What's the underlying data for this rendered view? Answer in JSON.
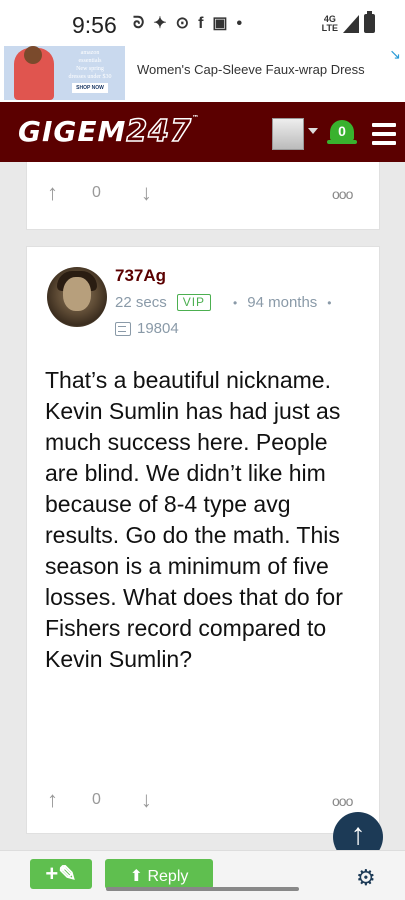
{
  "status_bar": {
    "time": "9:56",
    "network_top": "4G",
    "network_bottom": "LTE",
    "icons": [
      "game-icon",
      "twitter-icon",
      "radio-icon",
      "facebook-icon",
      "image-icon",
      "dot-icon"
    ]
  },
  "ad": {
    "image_line1": "amazon",
    "image_line2": "essentials",
    "image_line3": "New spring",
    "image_line4": "dresses under $30",
    "image_cta": "SHOP NOW",
    "title": "Women's Cap-Sleeve Faux-wrap Dress"
  },
  "header": {
    "logo_text": "GIGEM",
    "logo_number": "247",
    "logo_tm": "™",
    "notification_count": "0"
  },
  "prev_post": {
    "vote_count": "0"
  },
  "post": {
    "username": "737Ag",
    "time_ago": "22 secs",
    "badge": "VIP",
    "membership": "94 months",
    "post_count": "19804",
    "body": "That’s a beautiful nickname. Kevin Sumlin has had just as much success here. People are blind. We didn’t like him because of 8-4 type avg results. Go do the math. This season is a minimum of five losses. What does that do for Fishers record compared to Kevin Sumlin?",
    "vote_count": "0"
  },
  "actions": {
    "reply_label": "Reply"
  },
  "colors": {
    "brand": "#5b0000",
    "accent_green": "#5fbf4f",
    "scroll_button": "#1c3a56"
  }
}
